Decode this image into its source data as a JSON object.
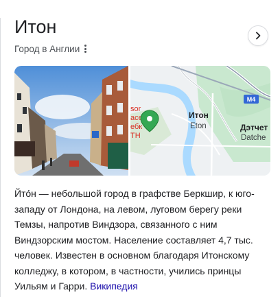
{
  "knowledge_panel": {
    "title": "Итон",
    "subtitle": "Город в Англии",
    "more_icon": "three-dots-vertical-icon",
    "next_icon": "chevron-right-icon",
    "description": "Йто́н — небольшой город в графстве Беркшир, к юго-западу от Лондона, на левом, луговом берегу реки Темзы, напротив Виндзора, связанного с ним Виндзорским мостом. Население составляет 4,7 тыс. человек. Известен в основном благодаря Итонскому колледжу, в котором, в частности, учились принцы Уильям и Гарри.",
    "source_link": "Википедия"
  },
  "map": {
    "place_ru": "Итон",
    "place_en": "Eton",
    "neighbor_ru": "Дэтчет",
    "neighbor_en": "Datche",
    "partial_label_line1": "sor",
    "partial_label_line2": "ace",
    "partial_label_line3": "ебк",
    "partial_label_line4": "ТН",
    "road_label": "M4",
    "colors": {
      "park": "#c9e8cf",
      "water": "#aadaff",
      "motorway": "#ffffff",
      "pin": "#34a853"
    }
  }
}
